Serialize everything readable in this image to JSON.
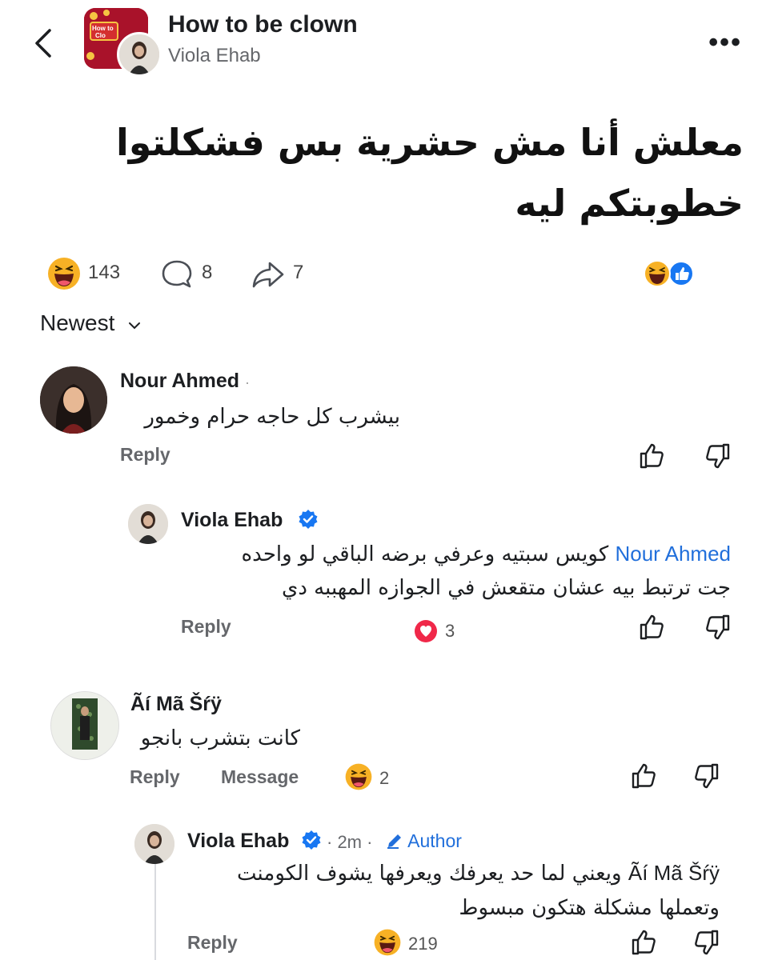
{
  "header": {
    "group_name": "How to be clown",
    "author": "Viola Ehab",
    "group_thumb_text": "How to be Clown"
  },
  "post": {
    "line1": "معلش أنا مش حشرية بس فشكلتوا",
    "line2": "خطوبتكم ليه"
  },
  "stats": {
    "reactions": "143",
    "comments": "8",
    "shares": "7"
  },
  "sort": {
    "label": "Newest"
  },
  "comments": [
    {
      "name": "Nour Ahmed",
      "dot": "·",
      "text": "بيشرب كل حاجه حرام وخمور",
      "reply": "Reply"
    },
    {
      "name": "Viola Ehab",
      "mention": "Nour Ahmed",
      "text_line1": "كويس سبتيه وعرفي برضه الباقي لو واحده",
      "text_line2": "جت ترتبط بيه عشان متقعش في الجوازه المهببه دي",
      "reply": "Reply",
      "reactions": "3"
    },
    {
      "name": "Ãí Mã Šŕÿ",
      "text": "كانت بتشرب بانجو",
      "reply": "Reply",
      "message": "Message",
      "reactions": "2"
    },
    {
      "name": "Viola Ehab",
      "time": "· 2m ·",
      "author_badge": "Author",
      "mention": "Ãí Mã Šŕÿ",
      "text_line1": "ويعني لما حد يعرفك ويعرفها يشوف الكومنت",
      "text_line2": "وتعملها مشكلة هتكون مبسوط",
      "reply": "Reply",
      "reactions": "219"
    }
  ],
  "colors": {
    "verified": "#1877f2",
    "mention": "#216fdb",
    "heart": "#f02849",
    "haha": "#f7b125"
  }
}
